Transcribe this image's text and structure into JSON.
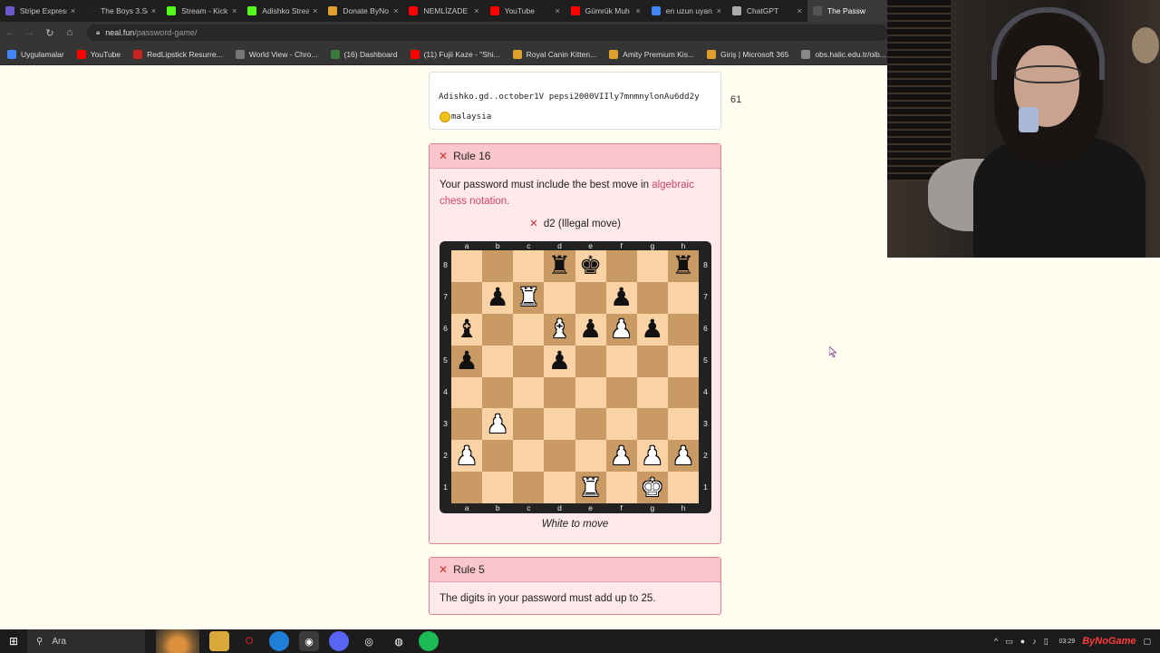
{
  "browser": {
    "tabs": [
      {
        "label": "Stripe Express",
        "color": "#6a5acd"
      },
      {
        "label": "The Boys 3.Se",
        "color": "#222222"
      },
      {
        "label": "Stream - Kick",
        "color": "#53fc18"
      },
      {
        "label": "Adishko Strea",
        "color": "#53fc18"
      },
      {
        "label": "Donate ByNo",
        "color": "#e0a030"
      },
      {
        "label": "NEMLİZADE",
        "color": "#ff0000"
      },
      {
        "label": "YouTube",
        "color": "#ff0000"
      },
      {
        "label": "Gümrük Muh",
        "color": "#ff0000"
      },
      {
        "label": "en uzun uyan",
        "color": "#4285f4"
      },
      {
        "label": "ChatGPT",
        "color": "#aaaaaa"
      },
      {
        "label": "The Passw",
        "color": "#555555",
        "active": true
      }
    ],
    "close_glyph": "×",
    "url_host": "neal.fun",
    "url_path": "/password-game/",
    "bookmarks": [
      {
        "label": "Uygulamalar",
        "color": "#4285f4"
      },
      {
        "label": "YouTube",
        "color": "#ff0000"
      },
      {
        "label": "RedLipstick Resurre...",
        "color": "#cc2222"
      },
      {
        "label": "World View - Chro...",
        "color": "#777777"
      },
      {
        "label": "(16) Dashboard",
        "color": "#3a7a3a"
      },
      {
        "label": "(11) Fujii Kaze - \"Shi...",
        "color": "#ff0000"
      },
      {
        "label": "Royal Canin Kitten...",
        "color": "#e0a030"
      },
      {
        "label": "Amity Premium Kis...",
        "color": "#e0a030"
      },
      {
        "label": "Giriş | Microsoft 365",
        "color": "#e0a030"
      },
      {
        "label": "obs.halic.edu.tr/oib...",
        "color": "#888888"
      }
    ]
  },
  "password": {
    "text_before": "Adishko.gd..october1V pepsi2000VIIly7mnmnylonAu6dd2y",
    "text_after": "malaysia",
    "emoji": "sun-face-emoji",
    "count": "61"
  },
  "rule16": {
    "title": "Rule 16",
    "text": "Your password must include the best move in ",
    "link": "algebraic chess notation.",
    "status": "d2 (Illegal move)",
    "to_move": "White to move"
  },
  "rule5": {
    "title": "Rule 5",
    "text": "The digits in your password must add up to 25."
  },
  "chess": {
    "files": [
      "a",
      "b",
      "c",
      "d",
      "e",
      "f",
      "g",
      "h"
    ],
    "ranks": [
      "8",
      "7",
      "6",
      "5",
      "4",
      "3",
      "2",
      "1"
    ],
    "pieces": [
      {
        "sq": "d8",
        "glyph": "♜",
        "color": "b",
        "name": "black-rook"
      },
      {
        "sq": "e8",
        "glyph": "♚",
        "color": "b",
        "name": "black-king"
      },
      {
        "sq": "h8",
        "glyph": "♜",
        "color": "b",
        "name": "black-rook"
      },
      {
        "sq": "b7",
        "glyph": "♟",
        "color": "b",
        "name": "black-pawn"
      },
      {
        "sq": "c7",
        "glyph": "♜",
        "color": "w",
        "name": "white-rook"
      },
      {
        "sq": "f7",
        "glyph": "♟",
        "color": "b",
        "name": "black-pawn"
      },
      {
        "sq": "a6",
        "glyph": "♝",
        "color": "b",
        "name": "black-bishop"
      },
      {
        "sq": "d6",
        "glyph": "♝",
        "color": "w",
        "name": "white-bishop"
      },
      {
        "sq": "e6",
        "glyph": "♟",
        "color": "b",
        "name": "black-pawn"
      },
      {
        "sq": "f6",
        "glyph": "♟",
        "color": "w",
        "name": "white-pawn"
      },
      {
        "sq": "g6",
        "glyph": "♟",
        "color": "b",
        "name": "black-pawn"
      },
      {
        "sq": "a5",
        "glyph": "♟",
        "color": "b",
        "name": "black-pawn"
      },
      {
        "sq": "d5",
        "glyph": "♟",
        "color": "b",
        "name": "black-pawn"
      },
      {
        "sq": "b3",
        "glyph": "♟",
        "color": "w",
        "name": "white-pawn"
      },
      {
        "sq": "a2",
        "glyph": "♟",
        "color": "w",
        "name": "white-pawn"
      },
      {
        "sq": "f2",
        "glyph": "♟",
        "color": "w",
        "name": "white-pawn"
      },
      {
        "sq": "g2",
        "glyph": "♟",
        "color": "w",
        "name": "white-pawn"
      },
      {
        "sq": "h2",
        "glyph": "♟",
        "color": "w",
        "name": "white-pawn"
      },
      {
        "sq": "e1",
        "glyph": "♜",
        "color": "w",
        "name": "white-rook"
      },
      {
        "sq": "g1",
        "glyph": "♚",
        "color": "w",
        "name": "white-king"
      }
    ]
  },
  "taskbar": {
    "search_label": "Ara",
    "clock_time": "03:29",
    "logo": "ByNoGame"
  },
  "colors": {
    "rule_error_bg": "#fde8ea",
    "rule_error_head": "#f9c6cb",
    "rule_error_x": "#d32f2f",
    "link": "#d64566",
    "board_light": "#f9d3a6",
    "board_dark": "#c99a64"
  }
}
